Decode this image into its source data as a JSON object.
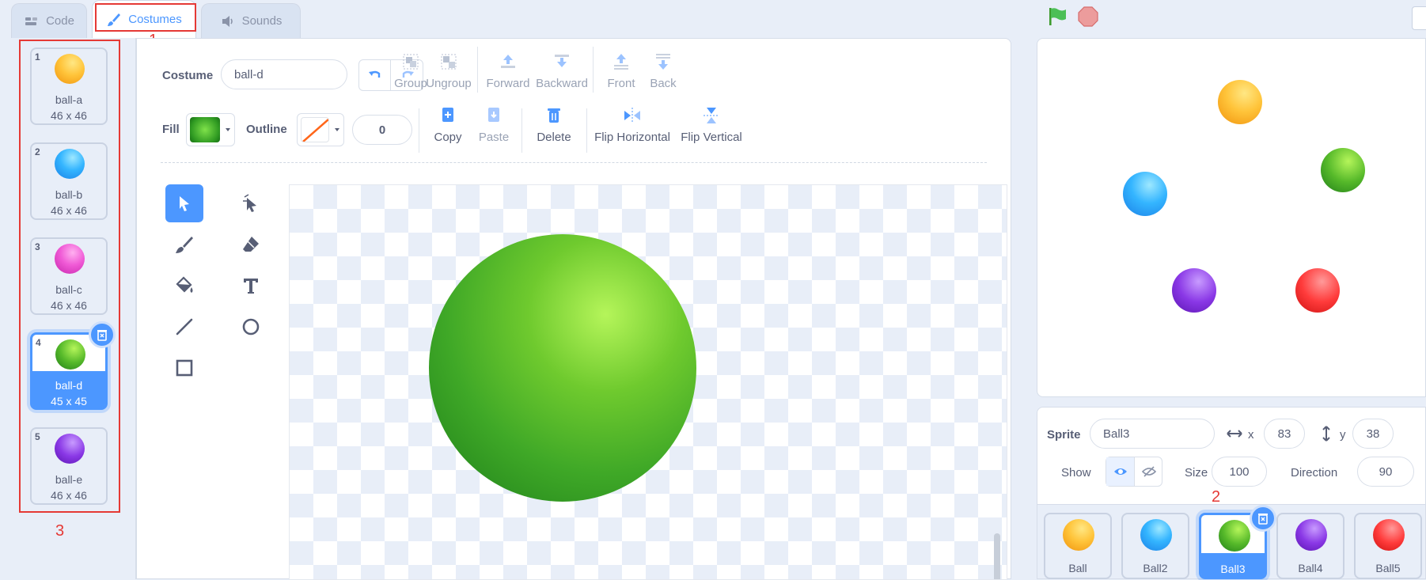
{
  "tabs": {
    "code": "Code",
    "costumes": "Costumes",
    "sounds": "Sounds"
  },
  "costumes": [
    {
      "num": "1",
      "name": "ball-a",
      "size": "46 x 46",
      "color": "yellow"
    },
    {
      "num": "2",
      "name": "ball-b",
      "size": "46 x 46",
      "color": "blue"
    },
    {
      "num": "3",
      "name": "ball-c",
      "size": "46 x 46",
      "color": "pink"
    },
    {
      "num": "4",
      "name": "ball-d",
      "size": "45 x 45",
      "color": "green",
      "selected": true
    },
    {
      "num": "5",
      "name": "ball-e",
      "size": "46 x 46",
      "color": "purple"
    }
  ],
  "annotations": {
    "one": "1",
    "two": "2",
    "three": "3"
  },
  "editor": {
    "costume_label": "Costume",
    "costume_name": "ball-d",
    "group": "Group",
    "ungroup": "Ungroup",
    "forward": "Forward",
    "backward": "Backward",
    "front": "Front",
    "back": "Back",
    "fill_label": "Fill",
    "outline_label": "Outline",
    "outline_width": "0",
    "copy": "Copy",
    "paste": "Paste",
    "delete": "Delete",
    "flip_horizontal": "Flip Horizontal",
    "flip_vertical": "Flip Vertical",
    "fill_color": "#3fa827",
    "accent": "#4c97ff"
  },
  "sprite_info": {
    "sprite_label": "Sprite",
    "sprite_name": "Ball3",
    "x_label": "x",
    "x_value": "83",
    "y_label": "y",
    "y_value": "38",
    "show_label": "Show",
    "size_label": "Size",
    "size_value": "100",
    "direction_label": "Direction",
    "direction_value": "90"
  },
  "sprites": [
    {
      "name": "Ball",
      "color": "yellow"
    },
    {
      "name": "Ball2",
      "color": "blue"
    },
    {
      "name": "Ball3",
      "color": "green",
      "selected": true
    },
    {
      "name": "Ball4",
      "color": "purple"
    },
    {
      "name": "Ball5",
      "color": "red"
    }
  ]
}
